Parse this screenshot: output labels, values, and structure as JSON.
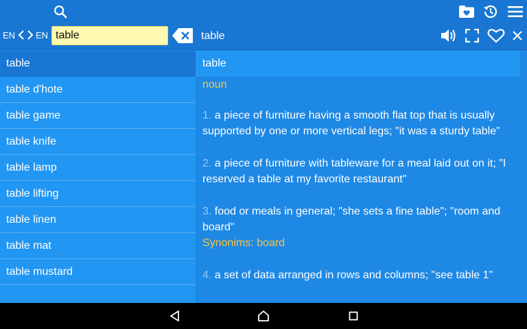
{
  "toolbar": {
    "source_lang": "EN",
    "target_lang": "EN",
    "search_value": "table",
    "current_word": "table"
  },
  "word_list": [
    "table",
    "table d'hote",
    "table game",
    "table knife",
    "table lamp",
    "table lifting",
    "table linen",
    "table mat",
    "table mustard"
  ],
  "definition": {
    "word": "table",
    "part_of_speech": "noun",
    "senses": [
      {
        "num": "1.",
        "text": "a piece of furniture having a smooth flat top that is usually supported by one or more vertical legs; \"it was a sturdy table\""
      },
      {
        "num": "2.",
        "text": "a piece of furniture with tableware for a meal laid out on it; \"I reserved a table at my favorite restaurant\""
      },
      {
        "num": "3.",
        "text": "food or meals in general; \"she sets a fine table\"; \"room and board\"",
        "synonyms": "Synonims: board"
      },
      {
        "num": "4.",
        "text": "a set of data arranged in rows and columns; \"see table 1\""
      }
    ]
  },
  "colors": {
    "accent": "#1976d2",
    "list_bg": "#2196f3",
    "highlight": "#f4c542",
    "search_bg": "#fff8b0"
  }
}
